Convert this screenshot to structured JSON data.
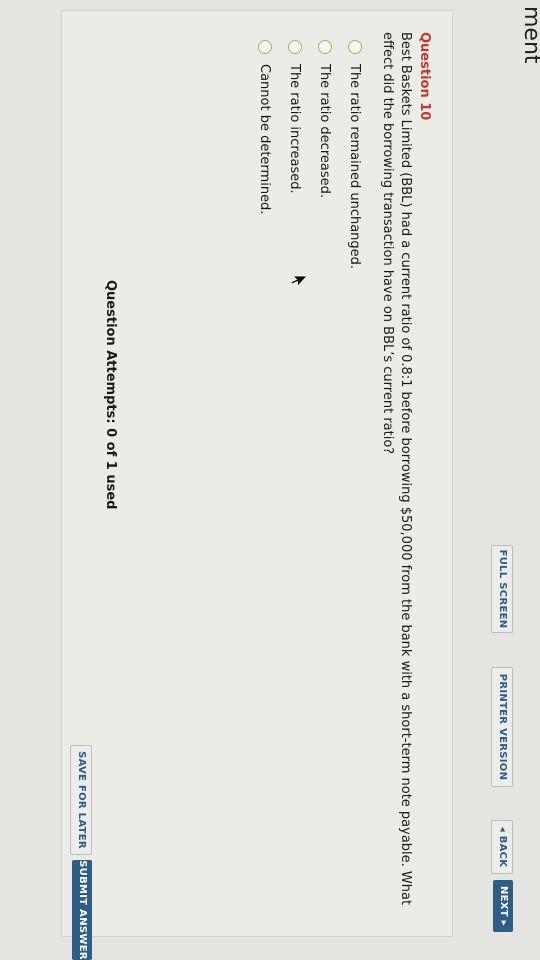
{
  "page": {
    "title_fragment": "ment"
  },
  "toolbar": {
    "full_screen": "FULL SCREEN",
    "printer_version": "PRINTER VERSION",
    "back": "◂ BACK",
    "next": "NEXT ▸"
  },
  "question": {
    "heading": "Question 10",
    "text": "Best Baskets Limited (BBL) had a current ratio of 0.8:1 before borrowing $50,000 from the bank with a short-term note payable. What effect did the borrowing transaction have on BBL’s current ratio?",
    "options": [
      "The ratio remained unchanged.",
      "The ratio decreased.",
      "The ratio increased.",
      "Cannot be determined."
    ]
  },
  "footer": {
    "attempts": "Question Attempts: 0 of 1 used",
    "save_later": "SAVE FOR LATER",
    "submit": "SUBMIT ANSWER"
  },
  "colors": {
    "accent_blue": "#2f5d86",
    "question_red": "#c0392b",
    "radio_green": "#9bbe4b"
  }
}
